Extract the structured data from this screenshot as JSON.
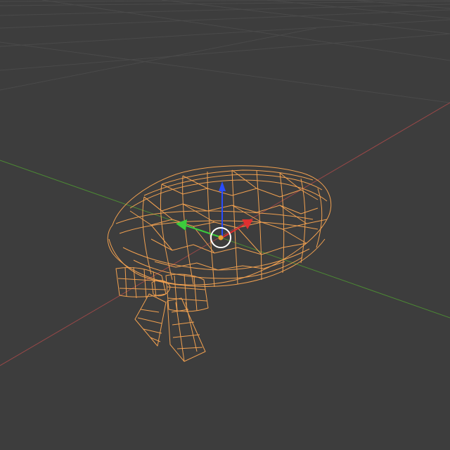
{
  "app": {
    "view": "3D Viewport",
    "shading_mode": "wireframe"
  },
  "colors": {
    "background": "#3d3d3d",
    "grid_line": "#4a4a4a",
    "axis_x": "#9a4848",
    "axis_y": "#4c8a34",
    "wireframe_selected": "#f0a050",
    "gizmo_z": "#2a4cff",
    "gizmo_y": "#3ccc3c",
    "gizmo_x": "#e03030",
    "cursor_ring": "#ffffff",
    "origin_dot": "#e8a030"
  },
  "scene": {
    "selected_object": "beret-with-bow",
    "transform_gizmo": "move",
    "icons": [
      "3d-cursor-icon",
      "object-origin-icon",
      "move-gizmo-icon"
    ]
  }
}
